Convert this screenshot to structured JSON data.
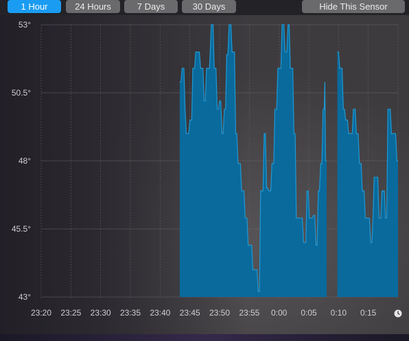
{
  "toolbar": {
    "range_buttons": [
      "1 Hour",
      "24 Hours",
      "7 Days",
      "30 Days"
    ],
    "active_range": "1 Hour",
    "hide_button": "Hide This Sensor"
  },
  "colors": {
    "accent": "#1a9cf2",
    "area_fill": "#0a6a9c",
    "area_stroke": "#1e9ad6"
  },
  "x_end_icon": "clock-icon",
  "chart_data": {
    "type": "area",
    "ylim": [
      43,
      53
    ],
    "y_ticks": [
      53,
      50.5,
      48,
      45.5,
      43
    ],
    "y_tick_labels": [
      "53°",
      "50.5°",
      "48°",
      "45.5°",
      "43°"
    ],
    "x_tick_labels": [
      "23:20",
      "23:25",
      "23:30",
      "23:35",
      "23:40",
      "23:45",
      "23:50",
      "23:55",
      "0:00",
      "0:05",
      "0:10",
      "0:15"
    ],
    "x_tick_minutes": [
      0,
      5,
      10,
      15,
      20,
      25,
      30,
      35,
      40,
      45,
      50,
      55
    ],
    "x_range_minutes": [
      0,
      60
    ],
    "grid": true,
    "segments": [
      [
        [
          23.3,
          50.9
        ],
        [
          23.5,
          50.9
        ],
        [
          23.7,
          51.4
        ],
        [
          24.0,
          51.4
        ],
        [
          24.2,
          49.9
        ],
        [
          24.4,
          49.0
        ],
        [
          24.8,
          49.0
        ],
        [
          25.0,
          49.5
        ],
        [
          25.3,
          49.5
        ],
        [
          25.5,
          51.4
        ],
        [
          25.8,
          51.4
        ],
        [
          26.0,
          52.0
        ],
        [
          26.6,
          52.0
        ],
        [
          26.8,
          51.4
        ],
        [
          27.2,
          51.4
        ],
        [
          27.4,
          50.2
        ],
        [
          27.6,
          50.2
        ],
        [
          27.8,
          51.4
        ],
        [
          28.3,
          51.4
        ],
        [
          28.6,
          53.0
        ],
        [
          28.9,
          53.0
        ],
        [
          29.1,
          51.4
        ],
        [
          29.4,
          51.4
        ],
        [
          29.6,
          49.9
        ],
        [
          29.8,
          49.9
        ],
        [
          30.0,
          50.2
        ],
        [
          30.2,
          50.2
        ],
        [
          30.4,
          49.0
        ],
        [
          30.6,
          49.0
        ],
        [
          30.8,
          49.9
        ],
        [
          31.0,
          49.9
        ],
        [
          31.2,
          51.9
        ],
        [
          31.4,
          51.9
        ],
        [
          31.6,
          53.0
        ],
        [
          31.9,
          53.0
        ],
        [
          32.1,
          52.0
        ],
        [
          32.5,
          52.0
        ],
        [
          32.7,
          49.0
        ],
        [
          32.9,
          49.0
        ],
        [
          33.1,
          47.9
        ],
        [
          33.5,
          47.9
        ],
        [
          33.7,
          46.9
        ],
        [
          34.1,
          46.9
        ],
        [
          34.3,
          45.9
        ],
        [
          34.6,
          45.9
        ],
        [
          34.8,
          44.9
        ],
        [
          35.4,
          44.9
        ],
        [
          35.6,
          44.0
        ],
        [
          36.3,
          44.0
        ],
        [
          36.5,
          43.2
        ],
        [
          36.7,
          43.2
        ],
        [
          36.9,
          46.9
        ],
        [
          37.3,
          46.9
        ],
        [
          37.5,
          49.0
        ],
        [
          37.7,
          49.0
        ],
        [
          37.9,
          47.0
        ],
        [
          38.1,
          47.0
        ],
        [
          38.3,
          46.9
        ],
        [
          38.6,
          46.9
        ],
        [
          38.8,
          47.9
        ],
        [
          39.1,
          47.9
        ],
        [
          39.3,
          49.9
        ],
        [
          39.6,
          49.9
        ],
        [
          39.8,
          51.4
        ],
        [
          40.3,
          51.4
        ],
        [
          40.5,
          53.0
        ],
        [
          40.8,
          53.0
        ],
        [
          41.0,
          52.0
        ],
        [
          41.3,
          52.0
        ],
        [
          41.5,
          53.0
        ],
        [
          41.7,
          53.0
        ],
        [
          41.9,
          51.4
        ],
        [
          42.3,
          51.4
        ],
        [
          42.5,
          49.0
        ],
        [
          42.7,
          49.0
        ],
        [
          42.9,
          45.9
        ],
        [
          43.9,
          45.9
        ],
        [
          44.1,
          45.0
        ],
        [
          44.5,
          45.0
        ],
        [
          44.7,
          46.9
        ],
        [
          44.9,
          46.9
        ],
        [
          45.1,
          45.9
        ],
        [
          45.6,
          45.9
        ],
        [
          45.8,
          46.0
        ],
        [
          46.0,
          46.0
        ],
        [
          46.2,
          44.9
        ],
        [
          46.4,
          44.9
        ],
        [
          46.6,
          46.9
        ],
        [
          46.8,
          46.9
        ],
        [
          47.0,
          47.9
        ],
        [
          47.2,
          47.9
        ],
        [
          47.4,
          49.9
        ],
        [
          47.6,
          49.9
        ],
        [
          47.7,
          50.9
        ],
        [
          47.8,
          48.0
        ],
        [
          48.0,
          48.0
        ]
      ],
      [
        [
          49.8,
          52.0
        ],
        [
          50.0,
          52.0
        ],
        [
          50.2,
          51.4
        ],
        [
          50.6,
          51.4
        ],
        [
          50.8,
          49.9
        ],
        [
          51.0,
          49.9
        ],
        [
          51.2,
          49.5
        ],
        [
          51.5,
          49.5
        ],
        [
          51.7,
          49.0
        ],
        [
          52.3,
          49.0
        ],
        [
          52.5,
          49.9
        ],
        [
          52.8,
          49.9
        ],
        [
          53.0,
          49.0
        ],
        [
          53.3,
          49.0
        ],
        [
          53.5,
          47.9
        ],
        [
          53.8,
          47.9
        ],
        [
          54.0,
          46.9
        ],
        [
          54.3,
          46.9
        ],
        [
          54.5,
          45.9
        ],
        [
          55.2,
          45.9
        ],
        [
          55.4,
          45.0
        ],
        [
          55.6,
          45.0
        ],
        [
          55.8,
          46.0
        ],
        [
          56.0,
          47.4
        ],
        [
          56.3,
          47.4
        ],
        [
          56.6,
          47.4
        ],
        [
          56.8,
          45.9
        ],
        [
          57.1,
          45.9
        ],
        [
          57.3,
          46.9
        ],
        [
          57.7,
          46.9
        ],
        [
          57.9,
          45.9
        ],
        [
          58.1,
          45.9
        ],
        [
          58.3,
          49.9
        ],
        [
          58.7,
          49.9
        ],
        [
          58.9,
          49.0
        ],
        [
          59.6,
          49.0
        ],
        [
          59.8,
          48.0
        ],
        [
          60.0,
          48.0
        ]
      ]
    ]
  }
}
